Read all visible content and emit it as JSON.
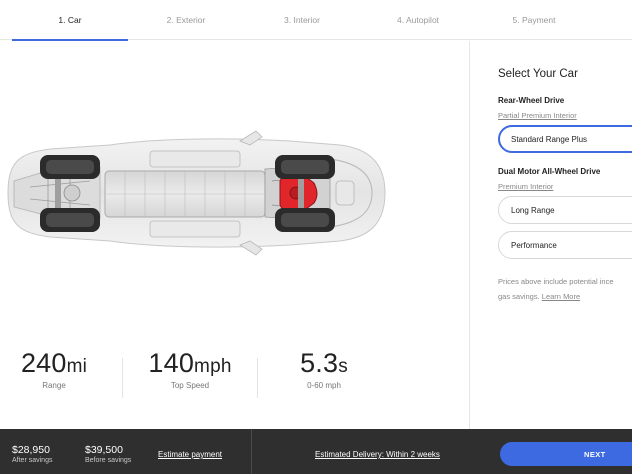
{
  "steps": [
    {
      "label": "1. Car"
    },
    {
      "label": "2. Exterior"
    },
    {
      "label": "3. Interior"
    },
    {
      "label": "4. Autopilot"
    },
    {
      "label": "5. Payment"
    }
  ],
  "stats": {
    "range": {
      "value": "240",
      "unit": "mi",
      "caption": "Range"
    },
    "top_speed": {
      "value": "140",
      "unit": "mph",
      "caption": "Top Speed"
    },
    "accel": {
      "value": "5.3",
      "unit": "s",
      "caption": "0-60 mph"
    }
  },
  "panel": {
    "title": "Select Your Car",
    "group_rwd": {
      "heading": "Rear-Wheel Drive",
      "interior": "Partial Premium Interior",
      "options": [
        "Standard Range Plus"
      ]
    },
    "group_awd": {
      "heading": "Dual Motor All-Wheel Drive",
      "interior": "Premium Interior",
      "options": [
        "Long Range",
        "Performance"
      ]
    },
    "note_line1": "Prices above include potential ince",
    "note_line2_prefix": "gas savings.",
    "learn_more": "Learn More"
  },
  "bottom": {
    "price_after": "$28,950",
    "price_after_label": "After savings",
    "price_before": "$39,500",
    "price_before_label": "Before savings",
    "estimate_payment": "Estimate payment",
    "delivery": "Estimated Delivery: Within 2 weeks",
    "next": "NEXT"
  },
  "colors": {
    "accent": "#3e6ae1",
    "bottom_bar": "#2f2f2f",
    "motor": "#e0262b"
  },
  "icons": {
    "car": "car-chassis-image"
  }
}
